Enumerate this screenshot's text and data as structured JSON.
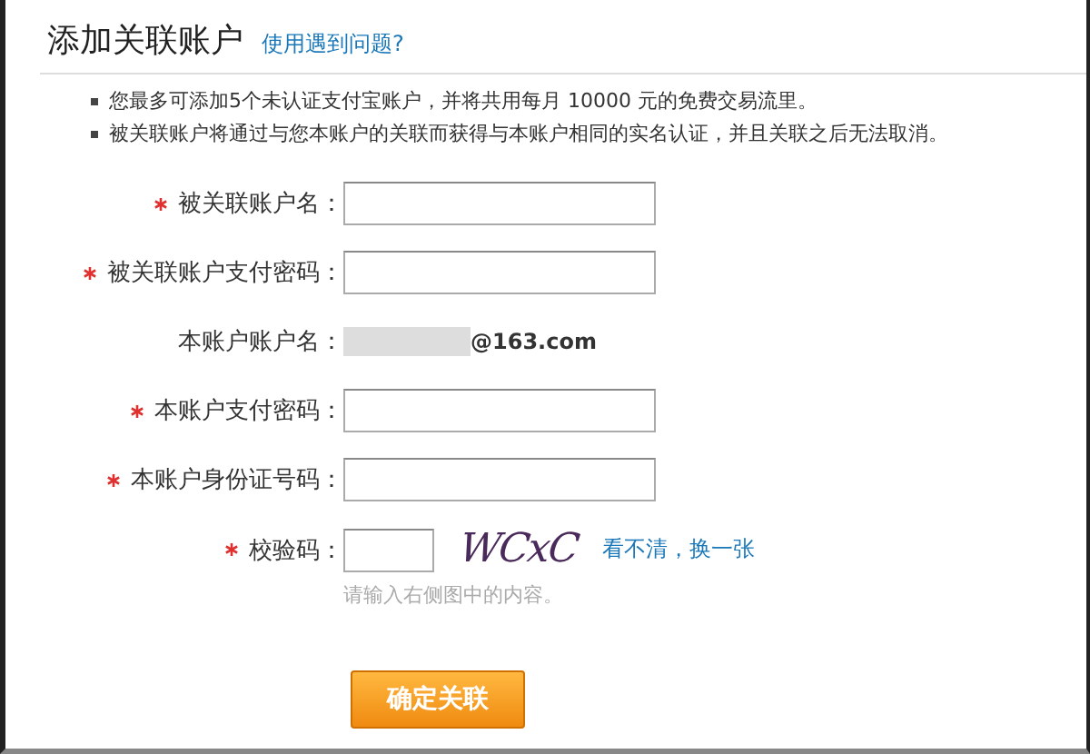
{
  "header": {
    "title": "添加关联账户",
    "help_link": "使用遇到问题?"
  },
  "notes": [
    "您最多可添加5个未认证支付宝账户，并将共用每月 10000 元的免费交易流里。",
    "被关联账户将通过与您本账户的关联而获得与本账户相同的实名认证，并且关联之后无法取消。"
  ],
  "form": [
    {
      "kind": "input",
      "label": "被关联账户名：",
      "required": true
    },
    {
      "kind": "input",
      "label": "被关联账户支付密码：",
      "required": true
    },
    {
      "kind": "static",
      "label": "本账户账户名：",
      "required": false,
      "value": "@163.com"
    },
    {
      "kind": "input",
      "label": "本账户支付密码：",
      "required": true
    },
    {
      "kind": "input",
      "label": "本账户身份证号码：",
      "required": true
    },
    {
      "kind": "captcha",
      "label": "校验码：",
      "required": true,
      "captcha_text": "WCxC",
      "refresh_link": "看不清，换一张",
      "hint": "请输入右侧图中的内容。"
    }
  ],
  "submit": "确定关联"
}
